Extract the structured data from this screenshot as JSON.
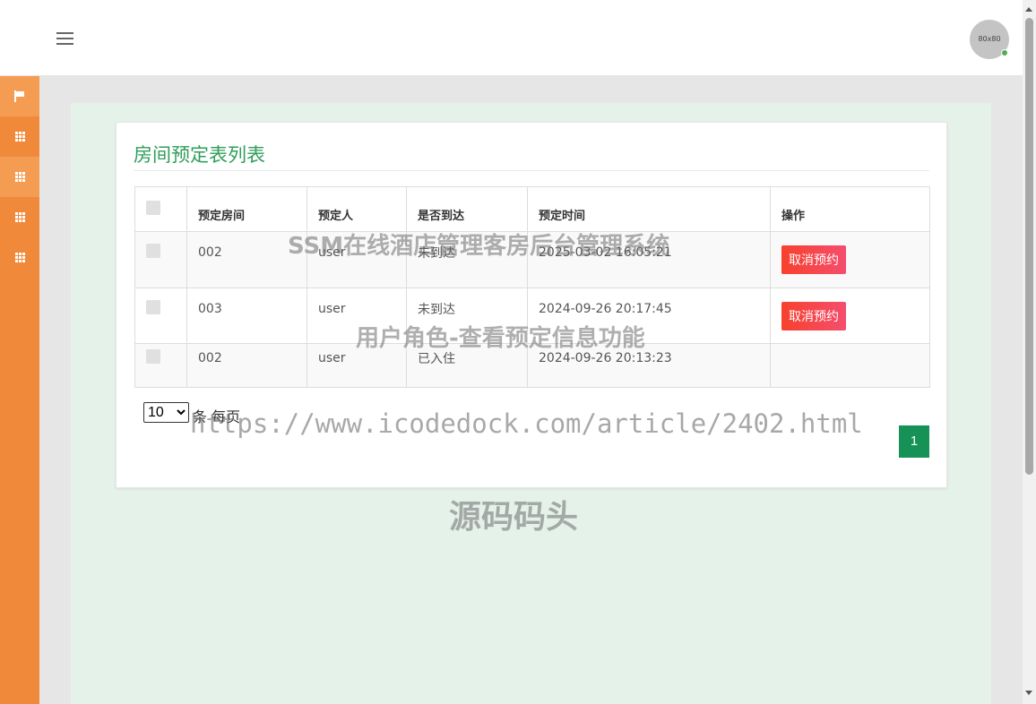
{
  "header": {
    "avatar_text": "80x80"
  },
  "sidebar": {
    "items": [
      "flag-icon",
      "grid-icon",
      "grid-icon",
      "grid-icon",
      "grid-icon"
    ]
  },
  "card": {
    "title": "房间预定表列表",
    "columns": [
      "预定房间",
      "预定人",
      "是否到达",
      "预定时间",
      "操作"
    ],
    "rows": [
      {
        "room": "002",
        "person": "user",
        "arrived": "未到达",
        "time": "2025-03-02 16:05:21",
        "action": "取消预约"
      },
      {
        "room": "003",
        "person": "user",
        "arrived": "未到达",
        "time": "2024-09-26 20:17:45",
        "action": "取消预约"
      },
      {
        "room": "002",
        "person": "user",
        "arrived": "已入住",
        "time": "2024-09-26 20:13:23",
        "action": ""
      }
    ]
  },
  "pager": {
    "page_size": "10",
    "per_page_label": "条 每页",
    "current_page": "1"
  },
  "watermarks": {
    "line1": "SSM在线酒店管理客房后台管理系统",
    "line2": "用户角色-查看预定信息功能",
    "line3": "https://www.icodedock.com/article/2402.html",
    "line4": "源码码头"
  },
  "colors": {
    "sidebar": "#f08a3a",
    "accent": "#2e9d5a",
    "danger": "#f7412d",
    "page_active": "#169257"
  }
}
